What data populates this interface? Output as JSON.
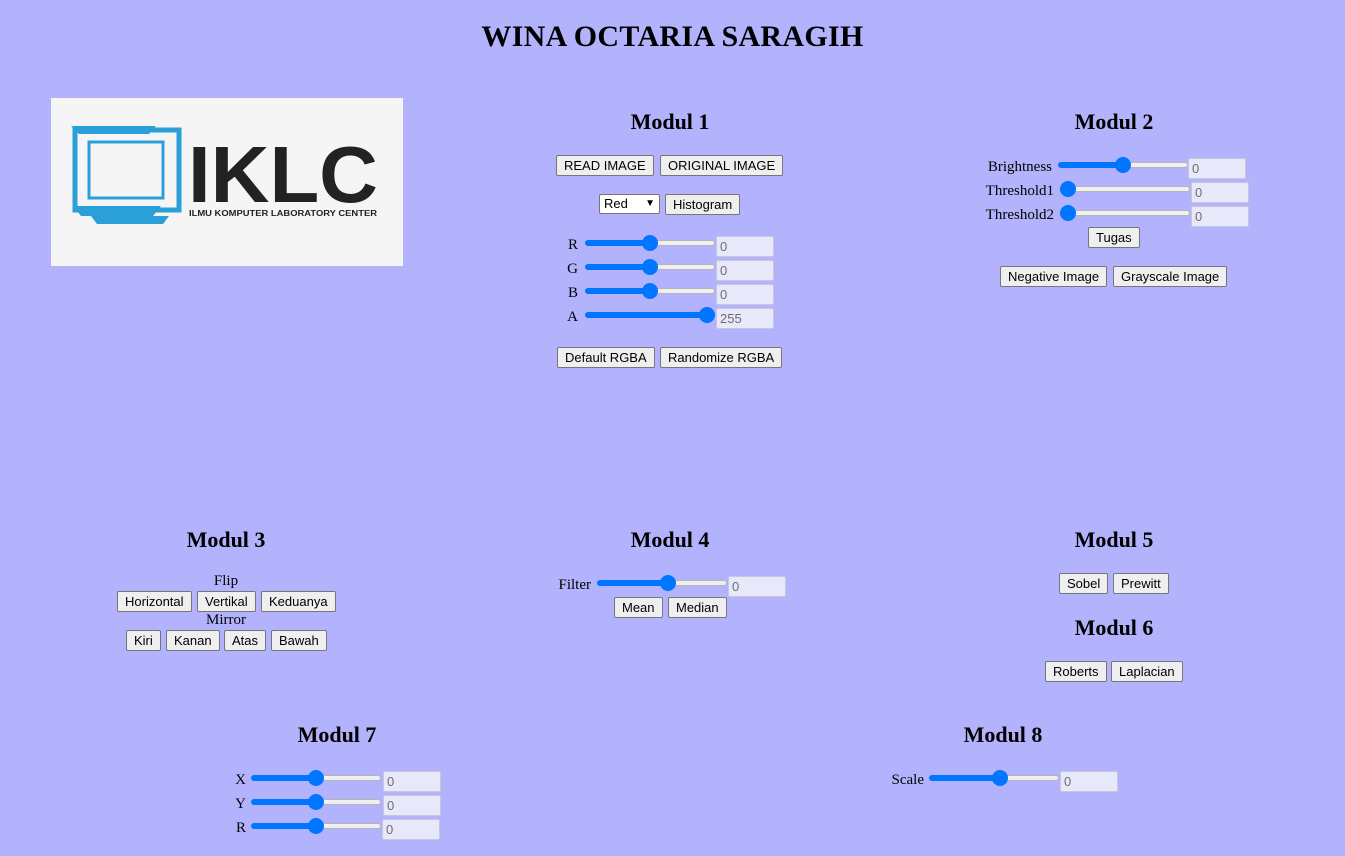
{
  "header": {
    "title": "WINA OCTARIA SARAGIH"
  },
  "logo": {
    "text": "IKLC",
    "subtitle": "ILMU KOMPUTER LABORATORY CENTER",
    "frame_color": "#2a9fd8"
  },
  "modul1": {
    "title": "Modul 1",
    "read_label": "READ IMAGE",
    "original_label": "ORIGINAL IMAGE",
    "channel_selected": "Red",
    "histogram_label": "Histogram",
    "sliders": [
      {
        "label": "R",
        "value": "0",
        "level": 0.5
      },
      {
        "label": "G",
        "value": "0",
        "level": 0.5
      },
      {
        "label": "B",
        "value": "0",
        "level": 0.5
      },
      {
        "label": "A",
        "value": "255",
        "level": 1.0
      }
    ],
    "default_label": "Default RGBA",
    "randomize_label": "Randomize RGBA"
  },
  "modul2": {
    "title": "Modul 2",
    "sliders": [
      {
        "label": "Brightness",
        "value": "0",
        "level": 0.5
      },
      {
        "label": "Threshold1",
        "value": "0",
        "level": 0.0
      },
      {
        "label": "Threshold2",
        "value": "0",
        "level": 0.0
      }
    ],
    "tugas_label": "Tugas",
    "negative_label": "Negative Image",
    "grayscale_label": "Grayscale Image"
  },
  "modul3": {
    "title": "Modul 3",
    "flip_label": "Flip",
    "flip_buttons": [
      "Horizontal",
      "Vertikal",
      "Keduanya"
    ],
    "mirror_label": "Mirror",
    "mirror_buttons": [
      "Kiri",
      "Kanan",
      "Atas",
      "Bawah"
    ]
  },
  "modul4": {
    "title": "Modul 4",
    "filter_label": "Filter",
    "filter_value": "0",
    "filter_level": 0.55,
    "mean_label": "Mean",
    "median_label": "Median"
  },
  "modul5": {
    "title": "Modul 5",
    "sobel_label": "Sobel",
    "prewitt_label": "Prewitt"
  },
  "modul6": {
    "title": "Modul 6",
    "roberts_label": "Roberts",
    "laplacian_label": "Laplacian"
  },
  "modul7": {
    "title": "Modul 7",
    "sliders": [
      {
        "label": "X",
        "value": "0",
        "level": 0.5
      },
      {
        "label": "Y",
        "value": "0",
        "level": 0.5
      },
      {
        "label": "R",
        "value": "0",
        "level": 0.5
      }
    ]
  },
  "modul8": {
    "title": "Modul 8",
    "scale_label": "Scale",
    "scale_value": "0",
    "scale_level": 0.55
  },
  "colors": {
    "background": "#b3b3fd",
    "accent": "#0075ff"
  }
}
